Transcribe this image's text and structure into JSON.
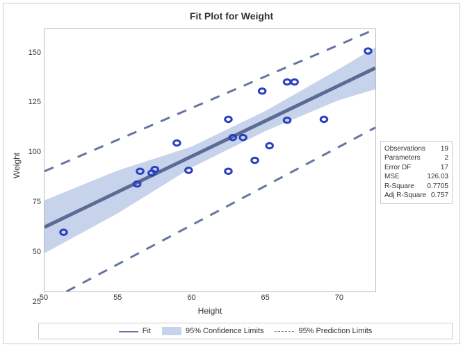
{
  "chart_data": {
    "type": "scatter",
    "title": "Fit Plot for Weight",
    "xlabel": "Height",
    "ylabel": "Weight",
    "xlim": [
      50,
      72.5
    ],
    "ylim": [
      18,
      162
    ],
    "xticks": [
      50,
      55,
      60,
      65,
      70
    ],
    "yticks": [
      25,
      50,
      75,
      100,
      125,
      150
    ],
    "series": [
      {
        "name": "points",
        "x": [
          51.3,
          56.3,
          56.5,
          57.3,
          57.5,
          59.0,
          59.8,
          62.5,
          62.5,
          62.8,
          63.5,
          64.3,
          64.8,
          65.3,
          66.5,
          66.5,
          67.0,
          69.0,
          72.0
        ],
        "y": [
          50.5,
          77.0,
          84.0,
          83.0,
          85.0,
          99.5,
          84.5,
          84.0,
          112.5,
          102.5,
          102.5,
          90.0,
          128.0,
          98.0,
          112.0,
          133.0,
          133.0,
          112.5,
          150.0
        ]
      }
    ],
    "fit_line": {
      "x": [
        50,
        72.5
      ],
      "y": [
        53.3,
        140.7
      ]
    },
    "confidence_band": {
      "x": [
        50,
        55,
        60,
        65,
        70,
        72.5
      ],
      "upper": [
        68,
        84.5,
        97.5,
        117,
        140,
        152
      ],
      "lower": [
        39,
        61,
        86,
        106,
        123,
        129
      ]
    },
    "prediction_band": {
      "upper": {
        "x": [
          50,
          72.5
        ],
        "y": [
          84,
          162
        ]
      },
      "lower": {
        "x": [
          51.5,
          72.5
        ],
        "y": [
          18,
          108
        ]
      }
    },
    "legend": {
      "fit": "Fit",
      "conf": "95% Confidence Limits",
      "pred": "95% Prediction Limits"
    }
  },
  "inset": [
    {
      "label": "Observations",
      "value": "19"
    },
    {
      "label": "Parameters",
      "value": "2"
    },
    {
      "label": "Error DF",
      "value": "17"
    },
    {
      "label": "MSE",
      "value": "126.03"
    },
    {
      "label": "R-Square",
      "value": "0.7705"
    },
    {
      "label": "Adj R-Square",
      "value": "0.757"
    }
  ]
}
